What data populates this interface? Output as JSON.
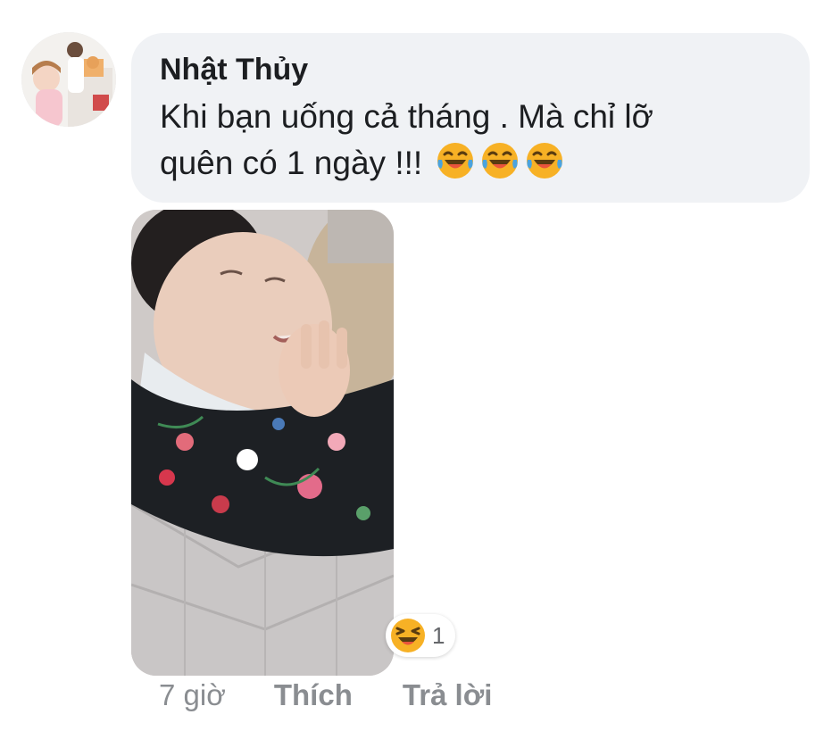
{
  "comment": {
    "author": "Nhật Thủy",
    "text": "Khi bạn uống cả tháng . Mà chỉ lỡ quên có 1 ngày !!!",
    "text_emojis": [
      "laughing-tears-emoji",
      "laughing-tears-emoji",
      "laughing-tears-emoji"
    ],
    "reaction": {
      "icon": "haha-reaction-icon",
      "count": "1"
    },
    "actions": {
      "time": "7 giờ",
      "like": "Thích",
      "reply": "Trả lời"
    }
  },
  "colors": {
    "bubble": "#f0f2f5",
    "text": "#1c1e21",
    "meta": "#8a8d91",
    "emoji_yellow": "#f7b125"
  }
}
